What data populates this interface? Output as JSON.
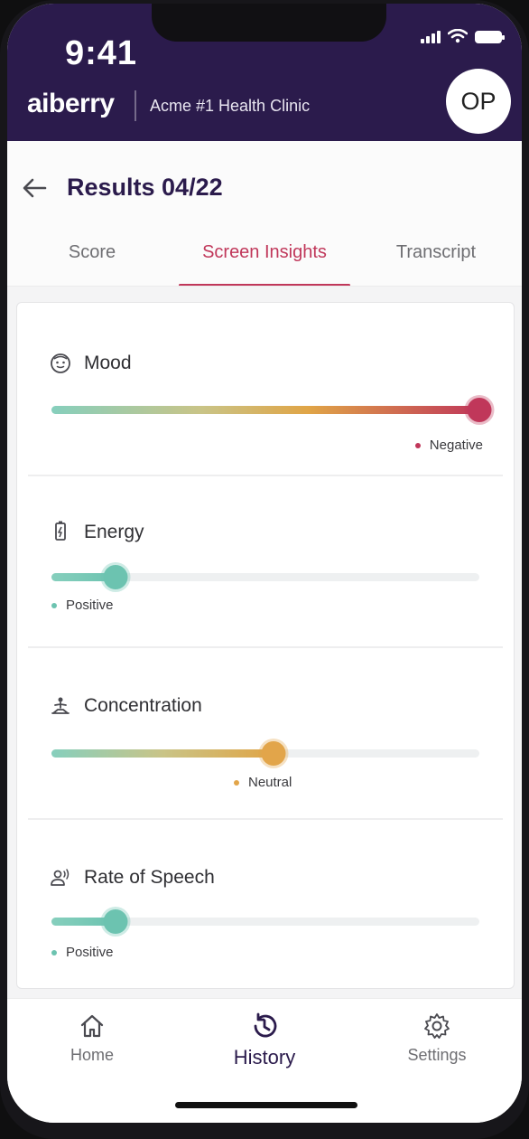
{
  "status_bar": {
    "time": "9:41"
  },
  "header": {
    "brand": "aiberry",
    "clinic": "Acme #1 Health Clinic",
    "avatar_initials": "OP"
  },
  "page": {
    "title": "Results 04/22"
  },
  "tabs": [
    {
      "label": "Score",
      "active": false
    },
    {
      "label": "Screen Insights",
      "active": true
    },
    {
      "label": "Transcript",
      "active": false
    }
  ],
  "metrics": [
    {
      "label": "Mood",
      "icon": "face-icon",
      "level": "Negative",
      "level_fraction": 1.0,
      "color": "#c0375a"
    },
    {
      "label": "Energy",
      "icon": "battery-icon",
      "level": "Positive",
      "level_fraction": 0.15,
      "color": "#6cc3b0"
    },
    {
      "label": "Concentration",
      "icon": "meditation-icon",
      "level": "Neutral",
      "level_fraction": 0.52,
      "color": "#e2a54a"
    },
    {
      "label": "Rate of Speech",
      "icon": "speaking-icon",
      "level": "Positive",
      "level_fraction": 0.15,
      "color": "#6cc3b0"
    }
  ],
  "bottom_nav": [
    {
      "label": "Home",
      "icon": "home-icon",
      "active": false
    },
    {
      "label": "History",
      "icon": "history-icon",
      "active": true
    },
    {
      "label": "Settings",
      "icon": "gear-icon",
      "active": false
    }
  ],
  "colors": {
    "header_bg": "#2b1b4c",
    "accent": "#c0375a",
    "positive": "#6cc3b0",
    "neutral": "#e2a54a",
    "negative": "#c0375a"
  }
}
